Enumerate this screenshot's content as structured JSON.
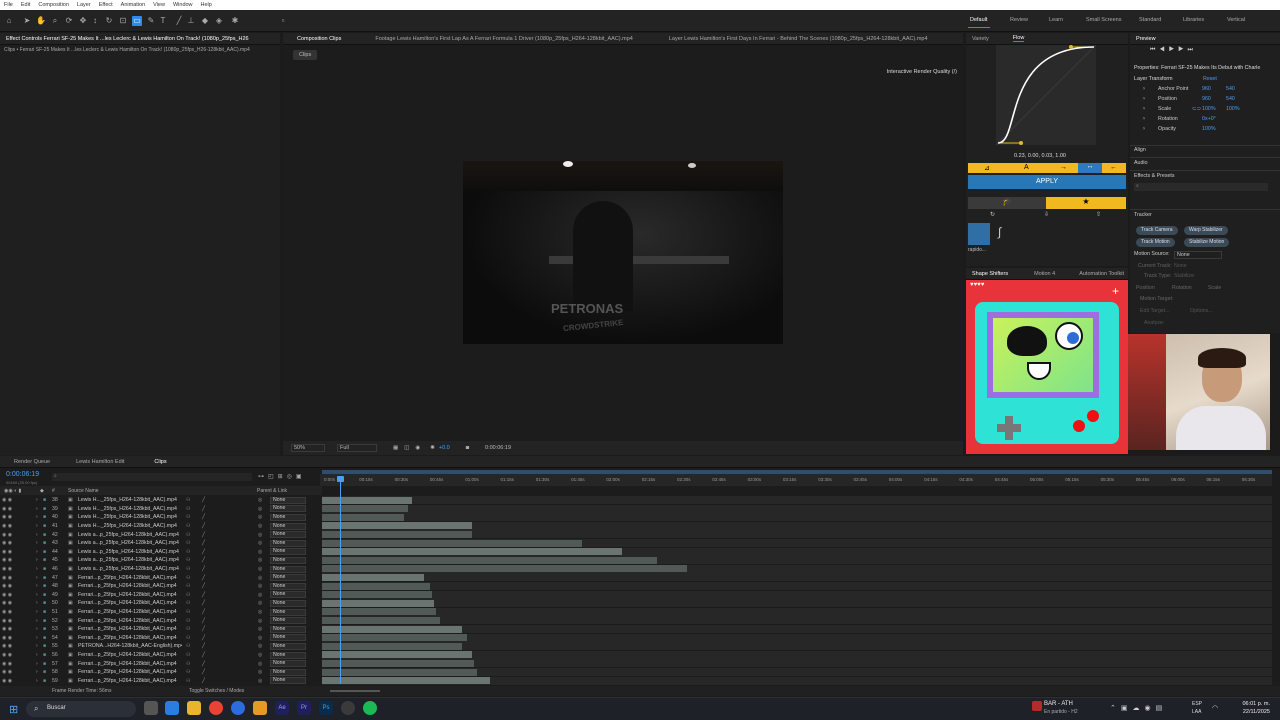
{
  "menu": [
    "File",
    "Edit",
    "Composition",
    "Layer",
    "Effect",
    "Animation",
    "View",
    "Window",
    "Help"
  ],
  "workspaces": [
    "Default",
    "Review",
    "Learn",
    "Small Screens",
    "Standard",
    "Libraries",
    "Vertical"
  ],
  "left_panel": {
    "tab": "Effect Controls Ferrari SF-25 Makes It ...les Leclerc & Lewis Hamilton On Track! (1080p_25fps_H26",
    "subtitle": "Clips • Ferrari SF-25 Makes It ...les Leclerc & Lewis Hamilton On Track! (1080p_25fps_H26-128kbit_AAC).mp4"
  },
  "viewer": {
    "tabs": [
      "Composition Clips",
      "Footage Lewis Hamilton's First Lap As A Ferrari Formula 1 Driver (1080p_25fps_H264-128kbit_AAC).mp4",
      "Layer Lewis Hamilton's First Days In Ferrari - Behind The Scenes (1080p_25fps_H264-128kbit_AAC).mp4"
    ],
    "chip": "Clips",
    "render_quality": "Interactive Render Quality (/)",
    "frame_text1": "PETRONAS",
    "frame_text2": "CROWDSTRIKE",
    "zoom": "50%",
    "res": "Full",
    "exposure": "+0.0",
    "timecode": "0:00:06:19"
  },
  "flow": {
    "tabs": [
      "Variety",
      "Flow"
    ],
    "curve": "0.23, 0.00, 0.03, 1.00",
    "apply": "APPLY",
    "preset_label": "rapido...",
    "bottom_tabs": [
      "Shape Shifters",
      "Motion 4",
      "Automation Toolkit"
    ]
  },
  "properties": {
    "preview": "Preview",
    "title": "Properties: Ferrari SF-25 Makes Its Debut with Charle",
    "section": "Layer Transform",
    "reset": "Reset",
    "rows": [
      {
        "label": "Anchor Point",
        "v1": "960",
        "v2": "540"
      },
      {
        "label": "Position",
        "v1": "960",
        "v2": "540"
      },
      {
        "label": "Scale",
        "v1": "100%",
        "v2": "100%"
      },
      {
        "label": "Rotation",
        "v1": "0x+0°",
        "v2": ""
      },
      {
        "label": "Opacity",
        "v1": "100%",
        "v2": ""
      }
    ],
    "align": "Align",
    "audio": "Audio",
    "effects": "Effects & Presets",
    "tracker": "Tracker",
    "track_buttons": [
      "Track Camera",
      "Warp Stabilizer",
      "Track Motion",
      "Stabilize Motion"
    ],
    "motion_source_label": "Motion Source:",
    "motion_source": "None",
    "current_track": "Current Track:",
    "track_type": "Track Type:",
    "stabilize": "Stabilize",
    "none": "None",
    "checks": [
      "Position",
      "Rotation",
      "Scale"
    ],
    "motion_target": "Motion Target:",
    "edit_target": "Edit Target...",
    "options": "Options...",
    "analyze": "Analyze:"
  },
  "timeline": {
    "tabs": [
      "Render Queue",
      "Lewis Hamilton Edit",
      "Clips"
    ],
    "timecode": "0:00:06:19",
    "timecode_sub": "00169 (25.00 fps)",
    "col_source": "Source Name",
    "col_parent": "Parent & Link",
    "ticks": [
      "0:00s",
      "00:15s",
      "00:30s",
      "00:45s",
      "01:00s",
      "01:15s",
      "01:30s",
      "01:45s",
      "02:00s",
      "02:15s",
      "02:30s",
      "02:45s",
      "03:00s",
      "03:15s",
      "03:30s",
      "03:45s",
      "04:00s",
      "04:15s",
      "04:30s",
      "04:45s",
      "05:00s",
      "05:15s",
      "05:30s",
      "05:45s",
      "06:00s",
      "06:15s",
      "06:30s"
    ],
    "footer_left": "Frame Render Time: 56ms",
    "footer_mid": "Toggle Switches / Modes",
    "rows": [
      {
        "n": "38",
        "name": "Lewis H..._25fps_H264-128kbit_AAC).mp4"
      },
      {
        "n": "39",
        "name": "Lewis H..._25fps_H264-128kbit_AAC).mp4"
      },
      {
        "n": "40",
        "name": "Lewis H..._25fps_H264-128kbit_AAC).mp4"
      },
      {
        "n": "41",
        "name": "Lewis H..._25fps_H264-128kbit_AAC).mp4"
      },
      {
        "n": "42",
        "name": "Lewis a...p_25fps_H264-128kbit_AAC).mp4"
      },
      {
        "n": "43",
        "name": "Lewis a...p_25fps_H264-128kbit_AAC).mp4"
      },
      {
        "n": "44",
        "name": "Lewis a...p_25fps_H264-128kbit_AAC).mp4"
      },
      {
        "n": "45",
        "name": "Lewis a...p_25fps_H264-128kbit_AAC).mp4"
      },
      {
        "n": "46",
        "name": "Lewis a...p_25fps_H264-128kbit_AAC).mp4"
      },
      {
        "n": "47",
        "name": "Ferrari...p_25fps_H264-128kbit_AAC).mp4"
      },
      {
        "n": "48",
        "name": "Ferrari...p_25fps_H264-128kbit_AAC).mp4"
      },
      {
        "n": "49",
        "name": "Ferrari...p_25fps_H264-128kbit_AAC).mp4"
      },
      {
        "n": "50",
        "name": "Ferrari...p_25fps_H264-128kbit_AAC).mp4"
      },
      {
        "n": "51",
        "name": "Ferrari...p_25fps_H264-128kbit_AAC).mp4"
      },
      {
        "n": "52",
        "name": "Ferrari...p_25fps_H264-128kbit_AAC).mp4"
      },
      {
        "n": "53",
        "name": "Ferrari...p_25fps_H264-128kbit_AAC).mp4"
      },
      {
        "n": "54",
        "name": "Ferrari...p_25fps_H264-128kbit_AAC).mp4"
      },
      {
        "n": "55",
        "name": "PETRONA...H264-128kbit_AAC-English).mp4"
      },
      {
        "n": "56",
        "name": "Ferrari...p_25fps_H264-128kbit_AAC).mp4"
      },
      {
        "n": "57",
        "name": "Ferrari...p_25fps_H264-128kbit_AAC).mp4"
      },
      {
        "n": "58",
        "name": "Ferrari...p_25fps_H264-128kbit_AAC).mp4"
      },
      {
        "n": "59",
        "name": "Ferrari...p_25fps_H264-128kbit_AAC).mp4"
      }
    ],
    "parent_value": "None"
  },
  "taskbar": {
    "search": "Buscar",
    "news_title": "BAR - ATH",
    "news_sub": "En partido - H2",
    "lang1": "ESP",
    "lang2": "LAA",
    "time": "06:01 p. m.",
    "date": "22/11/2025"
  }
}
